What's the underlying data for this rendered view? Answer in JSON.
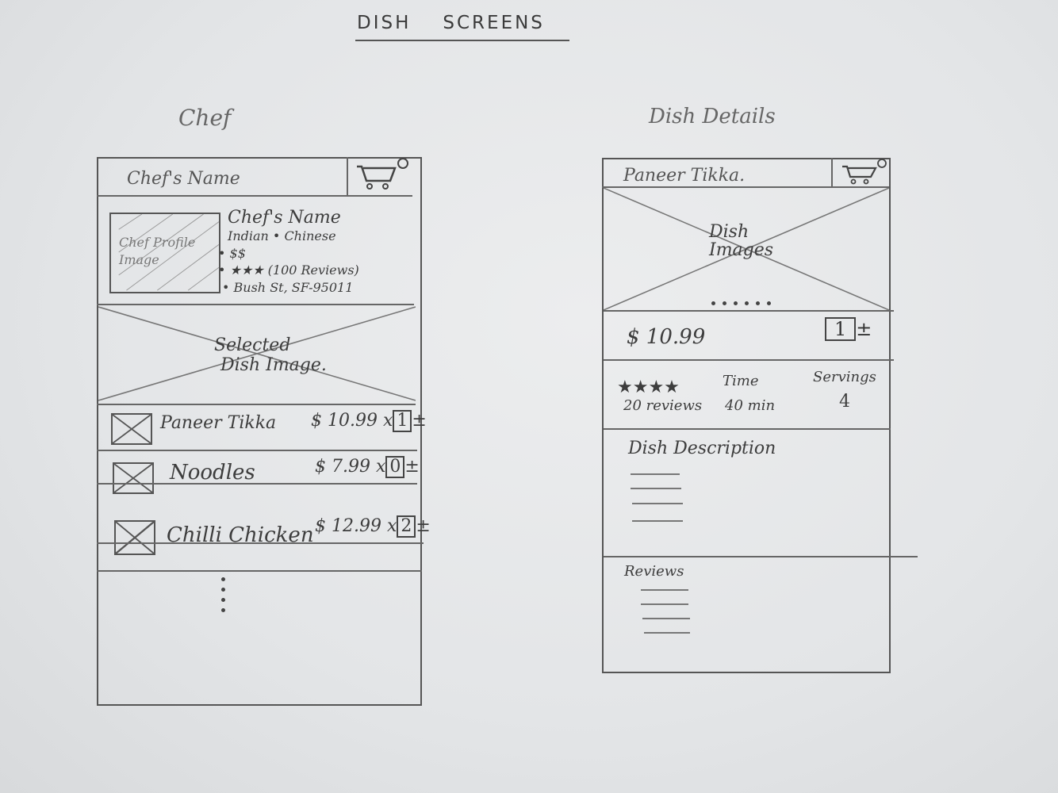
{
  "page_title_word1": "DISH",
  "page_title_word2": "SCREENS",
  "chef_screen": {
    "label": "Chef",
    "header_title": "Chef's Name",
    "profile_image_label": "Chef Profile Image",
    "info": {
      "name": "Chef's Name",
      "cuisine": "Indian • Chinese",
      "price": "• $$",
      "rating": "• ★★★ (100 Reviews)",
      "address": "• Bush St, SF-95011"
    },
    "selected_image_label_line1": "Selected",
    "selected_image_label_line2": "Dish Image.",
    "dishes": [
      {
        "name": "Paneer Tikka",
        "price": "$ 10.99 x",
        "qty": "1",
        "stepper": "±"
      },
      {
        "name": "Noodles",
        "price": "$ 7.99 x",
        "qty": "0",
        "stepper": "±"
      },
      {
        "name": "Chilli Chicken",
        "price": "$ 12.99 x",
        "qty": "2",
        "stepper": "±"
      }
    ]
  },
  "details_screen": {
    "label": "Dish Details",
    "header_title": "Paneer Tikka.",
    "image_label_line1": "Dish",
    "image_label_line2": "Images",
    "price": "$ 10.99",
    "qty": "1",
    "stepper": "±",
    "stats": {
      "rating_stars": "★★★★",
      "reviews": "20 reviews",
      "time_label": "Time",
      "time_value": "40 min",
      "servings_label": "Servings",
      "servings_value": "4"
    },
    "description_heading": "Dish Description",
    "reviews_heading": "Reviews"
  }
}
